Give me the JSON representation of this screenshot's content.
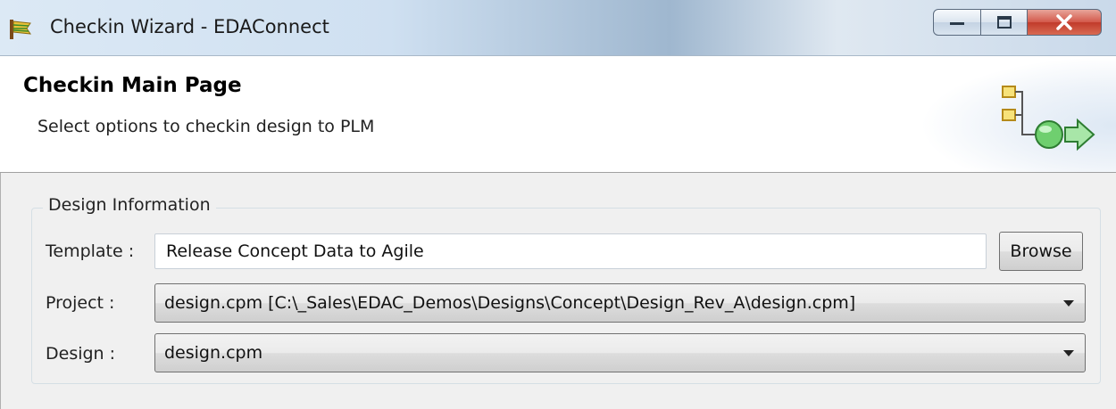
{
  "window": {
    "title": "Checkin Wizard - EDAConnect",
    "icons": {
      "app": "edaconnect-app-icon",
      "minimize": "minimize-icon",
      "maximize": "maximize-icon",
      "close": "close-icon"
    }
  },
  "header": {
    "title": "Checkin Main Page",
    "subtitle": "Select options to checkin design to PLM",
    "graphic_icon": "checkin-wizard-icon"
  },
  "design_info": {
    "legend": "Design Information",
    "template": {
      "label": "Template :",
      "value": "Release Concept Data to Agile"
    },
    "browse_label": "Browse",
    "project": {
      "label": "Project :",
      "selected": "design.cpm [C:\\_Sales\\EDAC_Demos\\Designs\\Concept\\Design_Rev_A\\design.cpm]"
    },
    "design": {
      "label": "Design :",
      "selected": "design.cpm"
    }
  },
  "colors": {
    "close_button": "#c13b2b",
    "title_bar": "#cfe0f1",
    "graphic_green": "#4caf50",
    "graphic_yellow": "#e0b33a"
  }
}
